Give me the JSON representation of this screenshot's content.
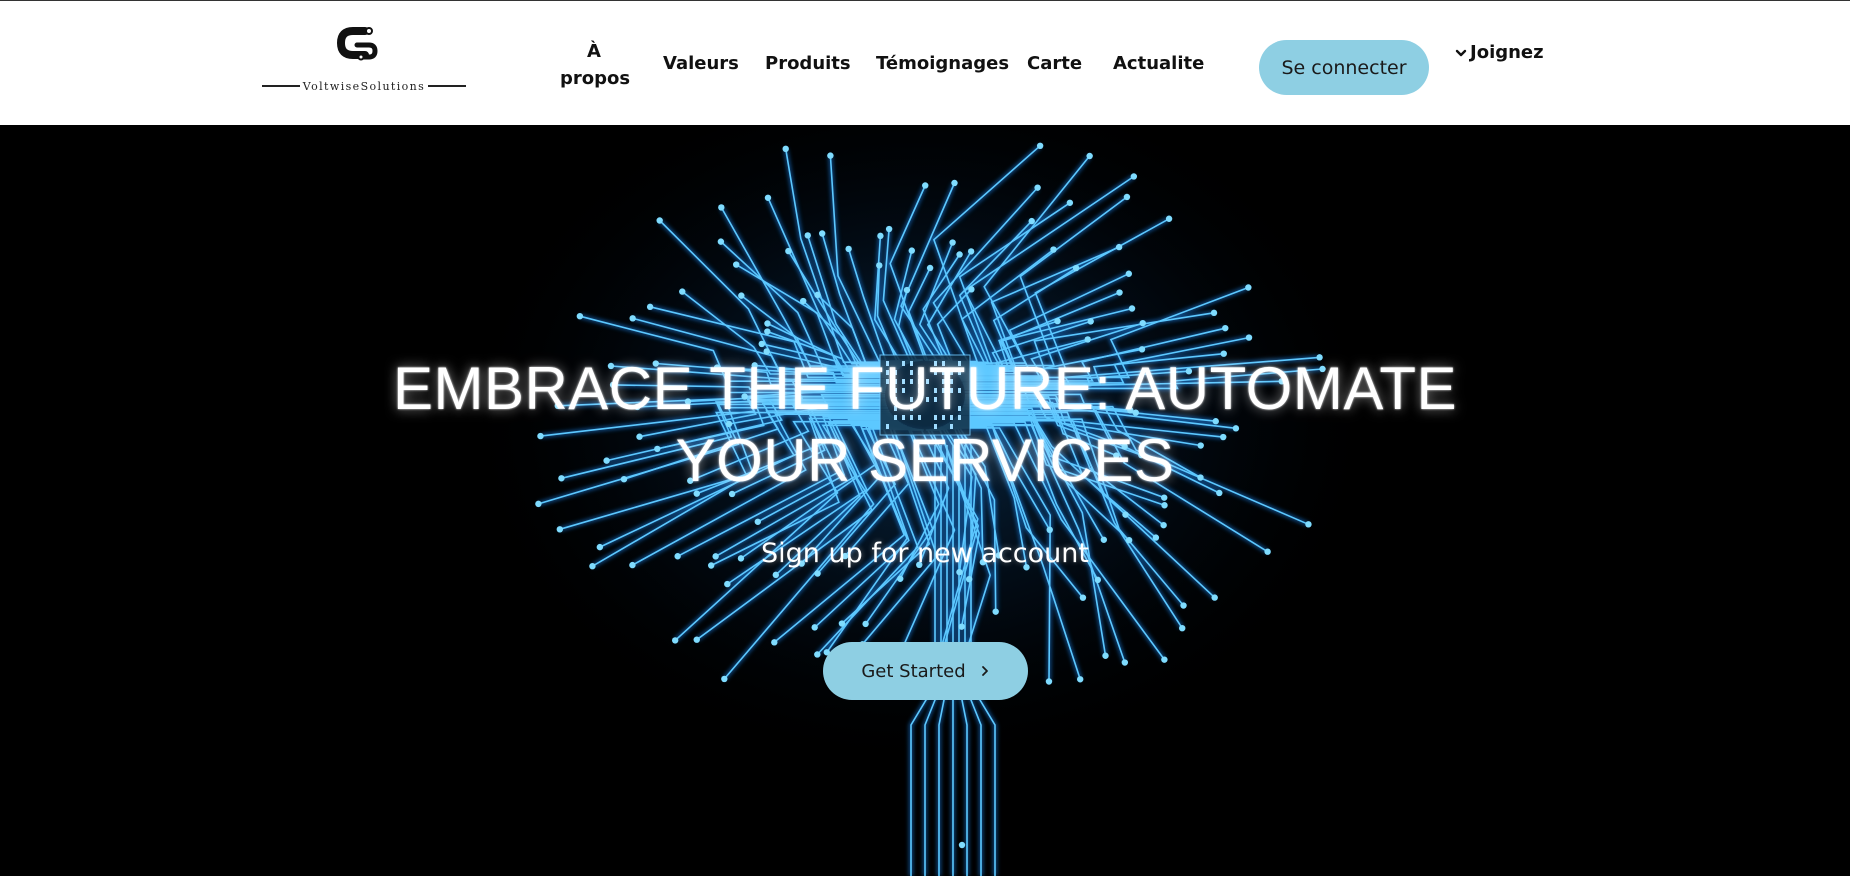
{
  "header": {
    "logo": {
      "name": "VoltwiseSolutions",
      "icon": "c-link-logo-icon"
    },
    "nav": [
      {
        "key": "apropos",
        "label": "À propos"
      },
      {
        "key": "valeurs",
        "label": "Valeurs"
      },
      {
        "key": "produits",
        "label": "Produits"
      },
      {
        "key": "temoignages",
        "label": "Témoignages"
      },
      {
        "key": "carte",
        "label": "Carte"
      },
      {
        "key": "actualite",
        "label": "Actualite"
      }
    ],
    "login_label": "Se connecter",
    "join_label": "Joignez",
    "join_icon": "chevron-down-icon"
  },
  "hero": {
    "background": "circuit-brain-image",
    "headline": "EMBRACE THE FUTURE: AUTOMATE YOUR SERVICES",
    "subline": "Sign up for new account",
    "cta_label": "Get Started",
    "cta_icon": "chevron-right-icon"
  },
  "colors": {
    "accent": "#8ecfe3",
    "header_bg": "#ffffff",
    "hero_bg": "#000000",
    "circuit_glow": "#3fb8ff"
  }
}
